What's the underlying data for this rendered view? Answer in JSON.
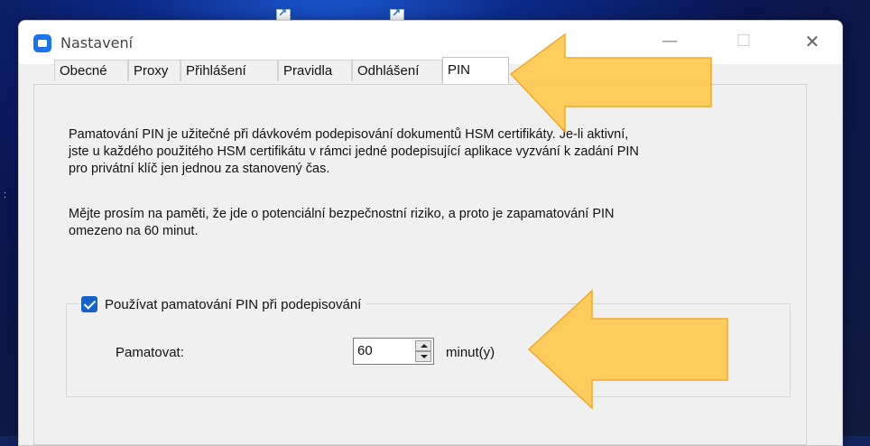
{
  "window": {
    "title": "Nastavení",
    "minimize": "—",
    "maximize": "☐",
    "close": "✕"
  },
  "tabs": [
    {
      "label": "Obecné"
    },
    {
      "label": "Proxy"
    },
    {
      "label": "Přihlášení"
    },
    {
      "label": "Pravidla"
    },
    {
      "label": "Odhlášení"
    },
    {
      "label": "PIN",
      "active": true
    }
  ],
  "pin": {
    "description_lines": [
      "Pamatování PIN je užitečné při dávkovém podepisování dokumentů HSM certifikáty. Je-li aktivní,",
      "jste u každého použitého HSM certifikátu v rámci jedné podepisující aplikace vyzvání k zadání PIN",
      "pro privátní klíč jen jednou za stanovený čas."
    ],
    "warning_lines": [
      "Mějte prosím na paměti, že jde o potenciální bezpečnostní riziko, a proto je zapamatování PIN",
      "omezeno na 60 minut."
    ],
    "enable_checkbox": {
      "label": "Používat pamatování PIN při podepisování",
      "checked": true
    },
    "remember_label": "Pamatovat:",
    "remember_value": "60",
    "unit": "minut(y)"
  },
  "colors": {
    "accent": "#1663c7",
    "arrow_fill": "#ffc94d",
    "arrow_stroke": "#f0a21a"
  },
  "icons": [
    "app-icon",
    "shortcut-icon",
    "arrow-annotation"
  ]
}
